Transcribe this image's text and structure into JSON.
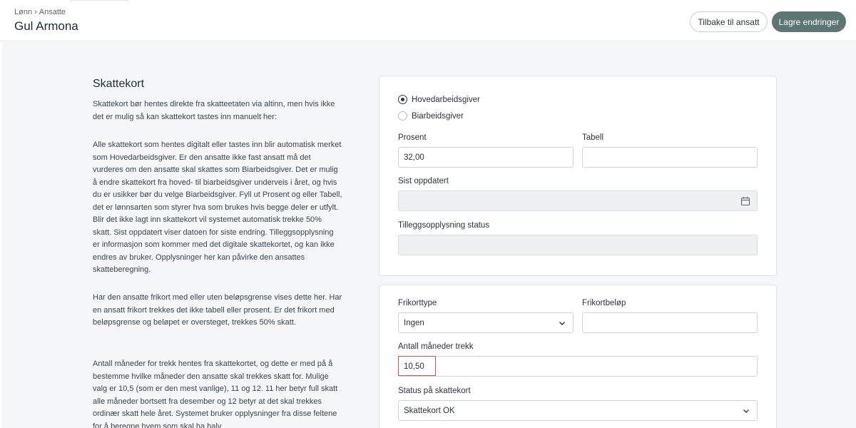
{
  "header": {
    "breadcrumb": {
      "root": "Lønn",
      "separator": "›",
      "current": "Ansatte"
    },
    "title": "Gul Armona",
    "back_button": "Tilbake til ansatt",
    "save_button": "Lagre endringer"
  },
  "section": {
    "title": "Skattekort",
    "paragraphs": [
      "Skattekort bør hentes direkte fra skatteetaten via altinn, men hvis ikke det er mulig så kan skattekort tastes inn manuelt her:",
      "Alle skattekort som hentes digitalt eller tastes inn blir automatisk merket som Hovedarbeidsgiver. Er den ansatte ikke fast ansatt må det vurderes om den ansatte skal skattes som Biarbeidsgiver. Det er mulig å endre skattekort fra hoved- til biarbeidsgiver underveis i året, og hvis du er usikker bør du velge Biarbeidsgiver. Fyll ut Prosent og eller Tabell, det er lønnsarten som styrer hva som brukes hvis begge deler er utfylt. Blir det ikke lagt inn skattekort vil systemet automatisk trekke 50% skatt. Sist oppdatert viser datoen for siste endring. Tilleggsopplysning er informasjon som kommer med det digitale skattekortet, og kan ikke endres av bruker. Opplysninger her kan påvirke den ansattes skatteberegning.",
      "Har den ansatte frikort med eller uten beløpsgrense vises dette her. Har en ansatt frikort trekkes det ikke tabell eller prosent. Er det frikort med beløpsgrense og beløpet er oversteget, trekkes 50% skatt.",
      "Antall måneder for trekk hentes fra skattekortet, og dette er med på å bestemme hvilke måneder den ansatte skal trekkes skatt for. Mulige valg er 10,5 (som er den mest vanlige), 11 og 12. 11 her betyr full skatt alle måneder bortsett fra desember og 12 betyr at det skal trekkes ordinær skatt hele året. Systemet bruker opplysninger fra disse feltene for å beregne hvem som skal ha halv"
    ]
  },
  "form": {
    "employer_options": [
      {
        "label": "Hovedarbeidsgiver",
        "checked": true
      },
      {
        "label": "Biarbeidsgiver",
        "checked": false
      }
    ],
    "percent": {
      "label": "Prosent",
      "value": "32,00"
    },
    "table": {
      "label": "Tabell",
      "value": ""
    },
    "last_updated": {
      "label": "Sist oppdatert",
      "value": ""
    },
    "additional_info_status": {
      "label": "Tilleggsopplysning status",
      "value": ""
    },
    "free_card_type": {
      "label": "Frikorttype",
      "value": "Ingen"
    },
    "free_card_amount": {
      "label": "Frikortbeløp",
      "value": ""
    },
    "months_deduction": {
      "label": "Antall måneder trekk",
      "value": "10,50"
    },
    "tax_card_status": {
      "label": "Status på skattekort",
      "value": "Skattekort OK"
    }
  },
  "colors": {
    "primary_button": "#5d7573",
    "highlight": "#d9534f",
    "background": "#f5f6f7"
  },
  "icons": {
    "calendar": "calendar-icon",
    "dropdown": "chevron-down-icon"
  }
}
